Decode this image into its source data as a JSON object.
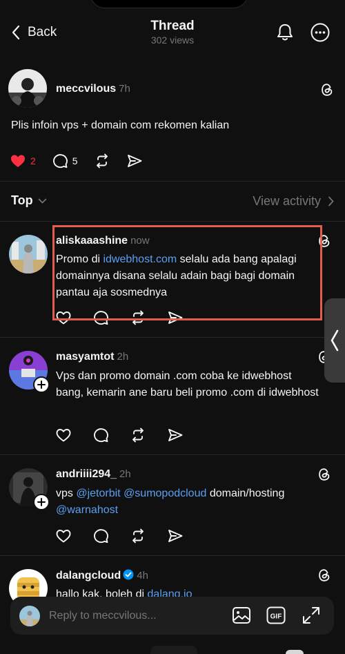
{
  "header": {
    "back_label": "Back",
    "title": "Thread",
    "views": "302 views"
  },
  "main_post": {
    "username": "meccvilous",
    "time": "7h",
    "text": "Plis infoin vps + domain com rekomen kalian",
    "likes": "2",
    "replies": "5"
  },
  "sort": {
    "top_label": "Top",
    "view_activity_label": "View activity"
  },
  "replies": [
    {
      "username": "aliskaaashine",
      "time": "now",
      "text_before_link": "Promo di ",
      "link": "idwebhost.com",
      "text_after_link": " selalu ada bang apalagi domainnya disana selalu adain bagi bagi domain pantau aja sosmednya"
    },
    {
      "username": "masyamtot",
      "time": "2h",
      "text": "Vps dan promo domain .com coba ke idwebhost bang, kemarin ane baru beli promo .com di idwebhost"
    },
    {
      "username": "andriiii294_",
      "time": "2h",
      "text_start": "vps ",
      "mention1": "@jetorbit",
      "mention2": "@sumopodcloud",
      "text_mid": " domain/hosting ",
      "mention3": "@warnahost"
    },
    {
      "username": "dalangcloud",
      "time": "4h",
      "text_start": "hallo kak, boleh di ",
      "link": "dalang.io"
    }
  ],
  "composer": {
    "placeholder": "Reply to meccvilous..."
  },
  "colors": {
    "background": "#101010",
    "text": "#f3f5f7",
    "muted": "#777777",
    "link": "#5aa0f2",
    "like_red": "#ff3040",
    "highlight_border": "#e25d4c"
  },
  "icons": [
    "back-chevron-icon",
    "bell-icon",
    "more-icon",
    "threads-logo-icon",
    "heart-icon",
    "comment-icon",
    "repost-icon",
    "share-icon",
    "chevron-down-icon",
    "chevron-right-icon",
    "follow-plus-icon",
    "verified-badge-icon",
    "image-icon",
    "gif-icon",
    "expand-icon"
  ]
}
